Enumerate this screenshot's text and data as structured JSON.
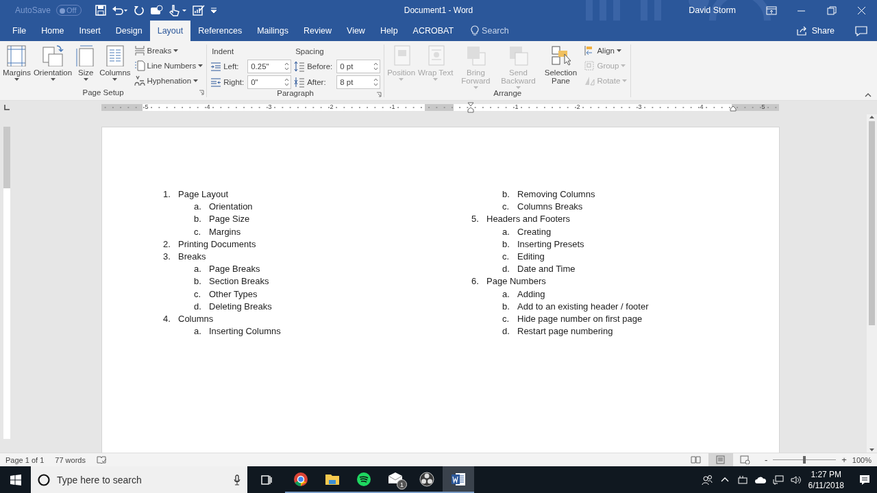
{
  "title_bar": {
    "autosave": {
      "label": "AutoSave",
      "toggle": "Off",
      "on": false
    },
    "title": "Document1  -  Word",
    "user": "David Storm"
  },
  "tabs": [
    {
      "label": "File",
      "selected": false
    },
    {
      "label": "Home",
      "selected": false
    },
    {
      "label": "Insert",
      "selected": false
    },
    {
      "label": "Design",
      "selected": false
    },
    {
      "label": "Layout",
      "selected": true
    },
    {
      "label": "References",
      "selected": false
    },
    {
      "label": "Mailings",
      "selected": false
    },
    {
      "label": "Review",
      "selected": false
    },
    {
      "label": "View",
      "selected": false
    },
    {
      "label": "Help",
      "selected": false
    },
    {
      "label": "ACROBAT",
      "selected": false
    }
  ],
  "tell_me": {
    "placeholder": "Search"
  },
  "share": "Share",
  "ribbon": {
    "page_setup": {
      "label": "Page Setup",
      "large_buttons": [
        {
          "label": "Margins",
          "kind": "margins"
        },
        {
          "label": "Orientation",
          "kind": "orientation"
        },
        {
          "label": "Size",
          "kind": "size"
        },
        {
          "label": "Columns",
          "kind": "columns"
        }
      ],
      "small_buttons": [
        {
          "label": "Breaks",
          "kind": "breaks"
        },
        {
          "label": "Line Numbers",
          "kind": "lines"
        },
        {
          "label": "Hyphenation",
          "kind": "hyphen"
        }
      ]
    },
    "paragraph": {
      "label": "Paragraph",
      "groups": [
        {
          "heading": "Indent",
          "fields": [
            {
              "label": "Left:",
              "value": "0.25\"",
              "kind": "indent-left"
            },
            {
              "label": "Right:",
              "value": "0\"",
              "kind": "indent-right"
            }
          ]
        },
        {
          "heading": "Spacing",
          "fields": [
            {
              "label": "Before:",
              "value": "0 pt",
              "kind": "space-before"
            },
            {
              "label": "After:",
              "value": "8 pt",
              "kind": "space-after"
            }
          ]
        }
      ]
    },
    "arrange": {
      "label": "Arrange",
      "large_buttons": [
        {
          "label": "Position",
          "kind": "position",
          "disabled": true,
          "dropdown": true
        },
        {
          "label": "Wrap Text",
          "kind": "wrap",
          "disabled": true,
          "dropdown": true
        },
        {
          "label": "Bring Forward",
          "kind": "forward",
          "disabled": true,
          "dropdown": true
        },
        {
          "label": "Send Backward",
          "kind": "backward",
          "disabled": true,
          "dropdown": true
        },
        {
          "label": "Selection Pane",
          "kind": "selection",
          "disabled": false,
          "dropdown": false
        }
      ],
      "small_buttons": [
        {
          "label": "Align",
          "kind": "align",
          "disabled": false
        },
        {
          "label": "Group",
          "kind": "group",
          "disabled": true
        },
        {
          "label": "Rotate",
          "kind": "rotate",
          "disabled": true
        }
      ]
    }
  },
  "ruler": {
    "left_labels": [
      "5",
      "4",
      "3",
      "2",
      "1"
    ],
    "right_labels": [
      "1",
      "2",
      "3",
      "4",
      "5"
    ]
  },
  "document": {
    "columns": [
      {
        "items": [
          {
            "marker": "1.",
            "text": "Page Layout",
            "children": [
              {
                "marker": "a.",
                "text": "Orientation"
              },
              {
                "marker": "b.",
                "text": "Page Size"
              },
              {
                "marker": "c.",
                "text": "Margins"
              }
            ]
          },
          {
            "marker": "2.",
            "text": "Printing Documents"
          },
          {
            "marker": "3.",
            "text": "Breaks",
            "children": [
              {
                "marker": "a.",
                "text": "Page Breaks"
              },
              {
                "marker": "b.",
                "text": "Section Breaks"
              },
              {
                "marker": "c.",
                "text": "Other Types"
              },
              {
                "marker": "d.",
                "text": "Deleting Breaks"
              }
            ]
          },
          {
            "marker": "4.",
            "text": "Columns",
            "children": [
              {
                "marker": "a.",
                "text": "Inserting Columns"
              }
            ]
          }
        ]
      },
      {
        "continued": [
          {
            "marker": "b.",
            "text": "Removing Columns"
          },
          {
            "marker": "c.",
            "text": "Columns Breaks"
          }
        ],
        "items": [
          {
            "marker": "5.",
            "text": "Headers and Footers",
            "children": [
              {
                "marker": "a.",
                "text": "Creating"
              },
              {
                "marker": "b.",
                "text": "Inserting Presets"
              },
              {
                "marker": "c.",
                "text": "Editing"
              },
              {
                "marker": "d.",
                "text": "Date and Time"
              }
            ]
          },
          {
            "marker": "6.",
            "text": "Page Numbers",
            "children": [
              {
                "marker": "a.",
                "text": "Adding"
              },
              {
                "marker": "b.",
                "text": "Add to an existing header / footer"
              },
              {
                "marker": "c.",
                "text": "Hide page number on first page"
              },
              {
                "marker": "d.",
                "text": "Restart page numbering"
              }
            ]
          }
        ]
      }
    ]
  },
  "status_bar": {
    "page": "Page 1 of 1",
    "words": "77 words",
    "views": [
      {
        "kind": "read",
        "selected": false
      },
      {
        "kind": "print",
        "selected": true
      },
      {
        "kind": "web",
        "selected": false
      }
    ],
    "zoom": {
      "minus": "-",
      "plus": "+",
      "level": 0.5,
      "reading": "100%"
    }
  },
  "taskbar": {
    "search": {
      "placeholder": "Type here to search"
    },
    "apps": [
      {
        "kind": "browser",
        "active": false
      },
      {
        "kind": "folder",
        "active": false
      },
      {
        "kind": "music",
        "active": false
      },
      {
        "kind": "mail",
        "active": false,
        "badge": "1"
      },
      {
        "kind": "shutter",
        "active": false
      },
      {
        "kind": "word",
        "active": true
      }
    ],
    "clock": {
      "time": "1:27 PM",
      "date": "6/11/2018"
    }
  }
}
